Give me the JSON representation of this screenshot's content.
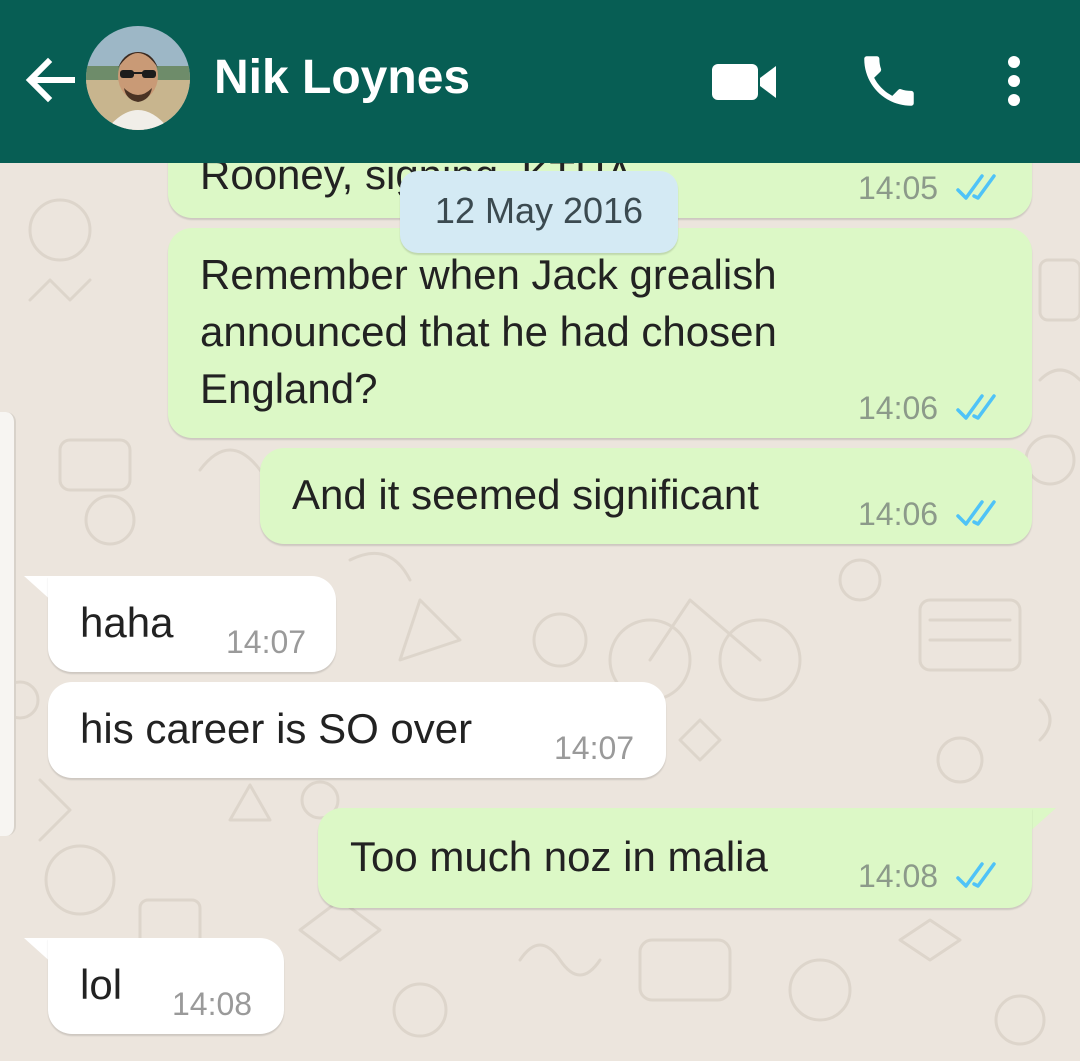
{
  "header": {
    "contact_name": "Nik Loynes",
    "back_icon": "arrow-left-icon",
    "video_icon": "video-camera-icon",
    "call_icon": "phone-icon",
    "menu_icon": "more-vert-icon",
    "background_color": "#075E54"
  },
  "date_chip": "12 May 2016",
  "messages": [
    {
      "direction": "out",
      "text": "Rooney, signing, KTHA",
      "time": "14:05",
      "status": "read"
    },
    {
      "direction": "out",
      "text": "Remember when Jack grealish\nannounced that he had chosen\nEngland?",
      "time": "14:06",
      "status": "read"
    },
    {
      "direction": "out",
      "text": "And it seemed significant",
      "time": "14:06",
      "status": "read"
    },
    {
      "direction": "in",
      "text": "haha",
      "time": "14:07"
    },
    {
      "direction": "in",
      "text": "his career is SO over",
      "time": "14:07"
    },
    {
      "direction": "out",
      "text": "Too much noz in malia",
      "time": "14:08",
      "status": "read"
    },
    {
      "direction": "in",
      "text": "lol",
      "time": "14:08"
    }
  ],
  "colors": {
    "outgoing_bubble": "#DCF8C6",
    "incoming_bubble": "#FFFFFF",
    "read_ticks": "#4FC3F7",
    "chat_background": "#ECE5DD"
  }
}
